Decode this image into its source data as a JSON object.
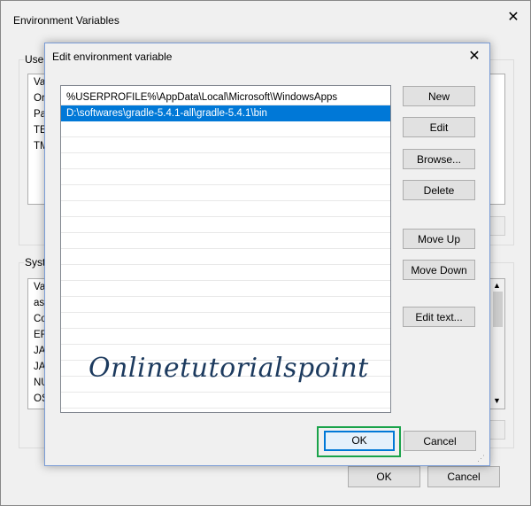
{
  "outer": {
    "title": "Environment Variables",
    "user_group_label": "User",
    "user_list": [
      "Va",
      "Or",
      "Pa",
      "TE",
      "TM"
    ],
    "system_group_label": "Syste",
    "system_list": [
      "Va",
      "asl",
      "Co",
      "ER",
      "JAV",
      "JAV",
      "NU",
      "OS"
    ],
    "ok_label": "OK",
    "cancel_label": "Cancel"
  },
  "dialog": {
    "title": "Edit environment variable",
    "paths": [
      "%USERPROFILE%\\AppData\\Local\\Microsoft\\WindowsApps",
      "D:\\softwares\\gradle-5.4.1-all\\gradle-5.4.1\\bin"
    ],
    "buttons": {
      "new": "New",
      "edit": "Edit",
      "browse": "Browse...",
      "delete": "Delete",
      "move_up": "Move Up",
      "move_down": "Move Down",
      "edit_text": "Edit text..."
    },
    "ok_label": "OK",
    "cancel_label": "Cancel"
  },
  "watermark": "Onlinetutorialspoint",
  "colors": {
    "selection": "#0078d7",
    "highlight_box": "#1aa34a",
    "watermark": "#1c3a5e"
  }
}
